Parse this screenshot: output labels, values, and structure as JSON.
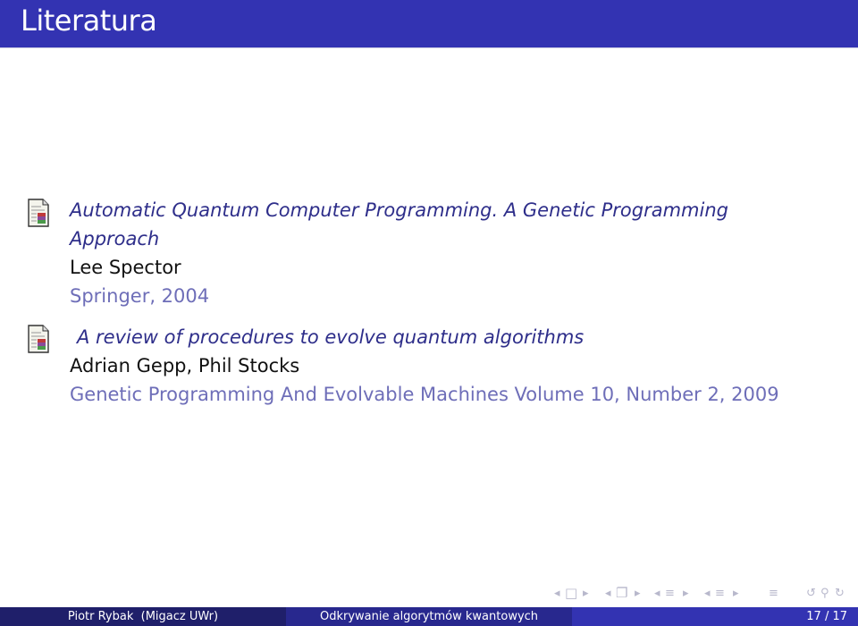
{
  "header": {
    "title": "Literatura"
  },
  "bibliography": [
    {
      "icon": "article-document-icon",
      "title_lines": [
        "Automatic Quantum Computer Programming. A Genetic Programming",
        "Approach"
      ],
      "authors": "Lee Spector",
      "publication": "Springer, 2004"
    },
    {
      "icon": "article-document-icon",
      "title_lines": [
        "A review of procedures to evolve quantum algorithms"
      ],
      "authors": "Adrian Gepp, Phil Stocks",
      "publication": "Genetic Programming And Evolvable Machines Volume 10, Number 2, 2009"
    }
  ],
  "navigation": {
    "icons": [
      "nav-prev-icon",
      "frame-icon",
      "nav-next-icon",
      "nav-prev-icon",
      "subsection-icon",
      "nav-next-icon",
      "nav-prev-icon",
      "section-icon",
      "nav-next-icon",
      "nav-prev-icon",
      "section-icon",
      "nav-next-icon",
      "outline-icon",
      "undo-icon",
      "search-icon",
      "redo-icon"
    ],
    "glyphs": {
      "left": "◂",
      "right": "▸",
      "frame": "□",
      "frames": "❐",
      "lines": "≡",
      "undo": "↺",
      "search": "⚲",
      "redo": "↻"
    }
  },
  "footer": {
    "author": "Piotr Rybak  (Migacz UWr)",
    "title": "Odkrywanie algorytmów kwantowych",
    "page": "17 / 17"
  },
  "colors": {
    "header_bg": "#3333b2",
    "title_text": "#2e2e8a",
    "publication_text": "#6e6eb8",
    "footer_left": "#1f1f6a",
    "footer_mid": "#28288e",
    "footer_right": "#3333b2"
  }
}
